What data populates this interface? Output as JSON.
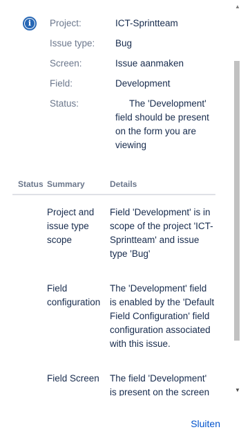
{
  "info": {
    "project_key": "Project:",
    "project_val": "ICT-Sprintteam",
    "issue_type_key": "Issue type:",
    "issue_type_val": "Bug",
    "screen_key": "Screen:",
    "screen_val": "Issue aanmaken",
    "field_key": "Field:",
    "field_val": "Development",
    "status_key": "Status:",
    "status_val": "The 'Development' field should be present on the form you are viewing"
  },
  "table": {
    "headers": {
      "status": "Status",
      "summary": "Summary",
      "details": "Details"
    },
    "rows": [
      {
        "summary": "Project and issue type scope",
        "details": "Field 'Development' is in scope of the project 'ICT-Sprintteam' and issue type 'Bug'"
      },
      {
        "summary": "Field configuration",
        "details": "The 'Development' field is enabled by the 'Default Field Configuration' field configuration associated with this issue."
      },
      {
        "summary": "Field Screen",
        "details": "The field 'Development' is present on the screen"
      }
    ]
  },
  "footer": {
    "close_label": "Sluiten"
  },
  "icons": {
    "info": "info-icon",
    "scroll_up": "triangle-up-icon",
    "scroll_down": "triangle-down-icon"
  },
  "colors": {
    "accent": "#2767b5",
    "link": "#0052cc",
    "muted": "#6b778c",
    "text": "#172b4d"
  }
}
